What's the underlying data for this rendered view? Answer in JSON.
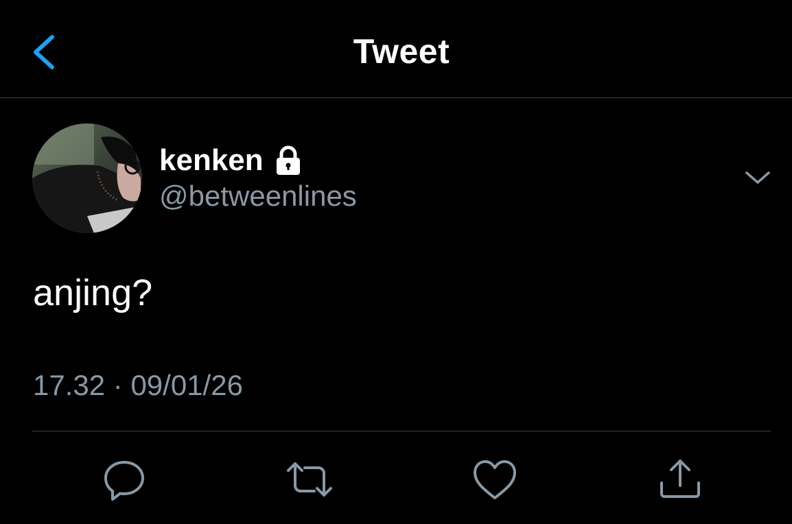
{
  "header": {
    "title": "Tweet",
    "back_icon": "chevron-left-icon"
  },
  "tweet": {
    "display_name": "kenken",
    "username": "@betweenlines",
    "protected_icon": "lock-icon",
    "text": "anjing?",
    "time": "17.32",
    "separator": "·",
    "date": "09/01/26"
  },
  "actions": [
    {
      "icon": "reply-icon"
    },
    {
      "icon": "retweet-icon"
    },
    {
      "icon": "like-icon"
    },
    {
      "icon": "share-icon"
    }
  ],
  "colors": {
    "background": "#000000",
    "primary_text": "#ffffff",
    "secondary_text": "#8899a6",
    "accent": "#1da1f2",
    "divider": "#38444d"
  }
}
